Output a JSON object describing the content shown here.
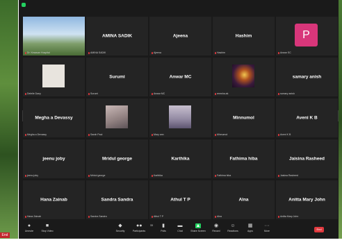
{
  "background": {
    "end_label": "End"
  },
  "tiles": [
    {
      "name": "",
      "label": "Dr. Kesavan Hospital",
      "kind": "photo-building",
      "speaker": true
    },
    {
      "name": "AMINA SADIK",
      "label": "AMINA SADIK"
    },
    {
      "name": "Ajeena",
      "label": "Ajeena"
    },
    {
      "name": "Hashim",
      "label": "Hashim"
    },
    {
      "name": "",
      "label": "Anwar SC",
      "kind": "avatar",
      "avatar_letter": "P"
    },
    {
      "name": "",
      "label": "Deleile Dany",
      "kind": "thumb-elephant"
    },
    {
      "name": "Surumi",
      "label": "Surumi"
    },
    {
      "name": "Anwar MC",
      "label": "Anwar MC"
    },
    {
      "name": "",
      "label": "remsha.ak",
      "kind": "thumb-music"
    },
    {
      "name": "samary anish",
      "label": "samary anish"
    },
    {
      "name": "Megha a Devassy",
      "label": "Megha a Devassy"
    },
    {
      "name": "",
      "label": "Sarah Paul",
      "kind": "thumb-tree"
    },
    {
      "name": "",
      "label": "Mary ann",
      "kind": "thumb-girl"
    },
    {
      "name": "Minnumol",
      "label": "Minnumol"
    },
    {
      "name": "Aveni K B",
      "label": "Aveni K B"
    },
    {
      "name": "jeenu joby",
      "label": "jeenu joby"
    },
    {
      "name": "Mridul george",
      "label": "Mridul george"
    },
    {
      "name": "Karthika",
      "label": "Karthika"
    },
    {
      "name": "Fathima hiba",
      "label": "Fathima hiba"
    },
    {
      "name": "Jaisina Rasheed",
      "label": "Jaisina Rasheed"
    },
    {
      "name": "Hana Zainab",
      "label": "Hana Zainab"
    },
    {
      "name": "Sandra Sandra",
      "label": "Sandra Sandra"
    },
    {
      "name": "Athul T P",
      "label": "Athul T P"
    },
    {
      "name": "Alna",
      "label": "Alna"
    },
    {
      "name": "Anitta Mary John",
      "label": "Anitta Mary John"
    }
  ],
  "toolbar": {
    "unmute": "Unmute",
    "stop_video": "Stop Video",
    "security": "Security",
    "participants": "Participants",
    "participants_count": "33",
    "polls": "Polls",
    "chat": "Chat",
    "share_screen": "Share Screen",
    "record": "Record",
    "reactions": "Reactions",
    "apps": "Apps",
    "more": "More",
    "end": "End"
  },
  "colors": {
    "speaker_outline": "#e3df2a",
    "share_green": "#23d160",
    "end_red": "#e0393e",
    "avatar_pink": "#d8367a"
  }
}
